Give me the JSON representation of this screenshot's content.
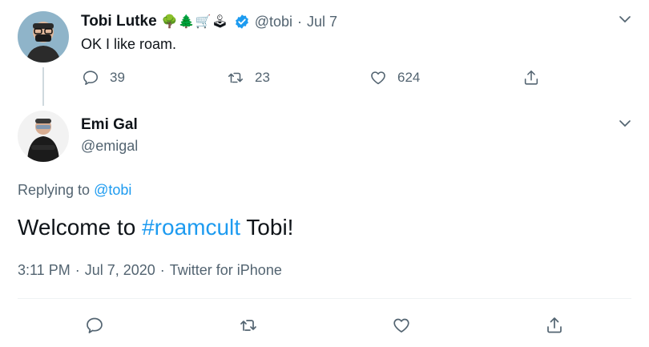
{
  "parent_tweet": {
    "author_name": "Tobi Lutke",
    "emojis": "🌳🌲🛒🕹",
    "handle": "@tobi",
    "separator": "·",
    "date": "Jul 7",
    "text": "OK I like roam.",
    "actions": {
      "reply_count": "39",
      "retweet_count": "23",
      "like_count": "624"
    }
  },
  "reply_tweet": {
    "author_name": "Emi Gal",
    "handle": "@emigal",
    "replying_prefix": "Replying to",
    "replying_handle": "@tobi",
    "text_before": "Welcome to ",
    "hashtag": "#roamcult",
    "text_after": " Tobi!",
    "meta": {
      "time": "3:11 PM",
      "sep1": "·",
      "date": "Jul 7, 2020",
      "sep2": "·",
      "source": "Twitter for iPhone"
    }
  },
  "colors": {
    "link": "#1d9bf0",
    "verified": "#1d9bf0",
    "muted": "#536471"
  }
}
